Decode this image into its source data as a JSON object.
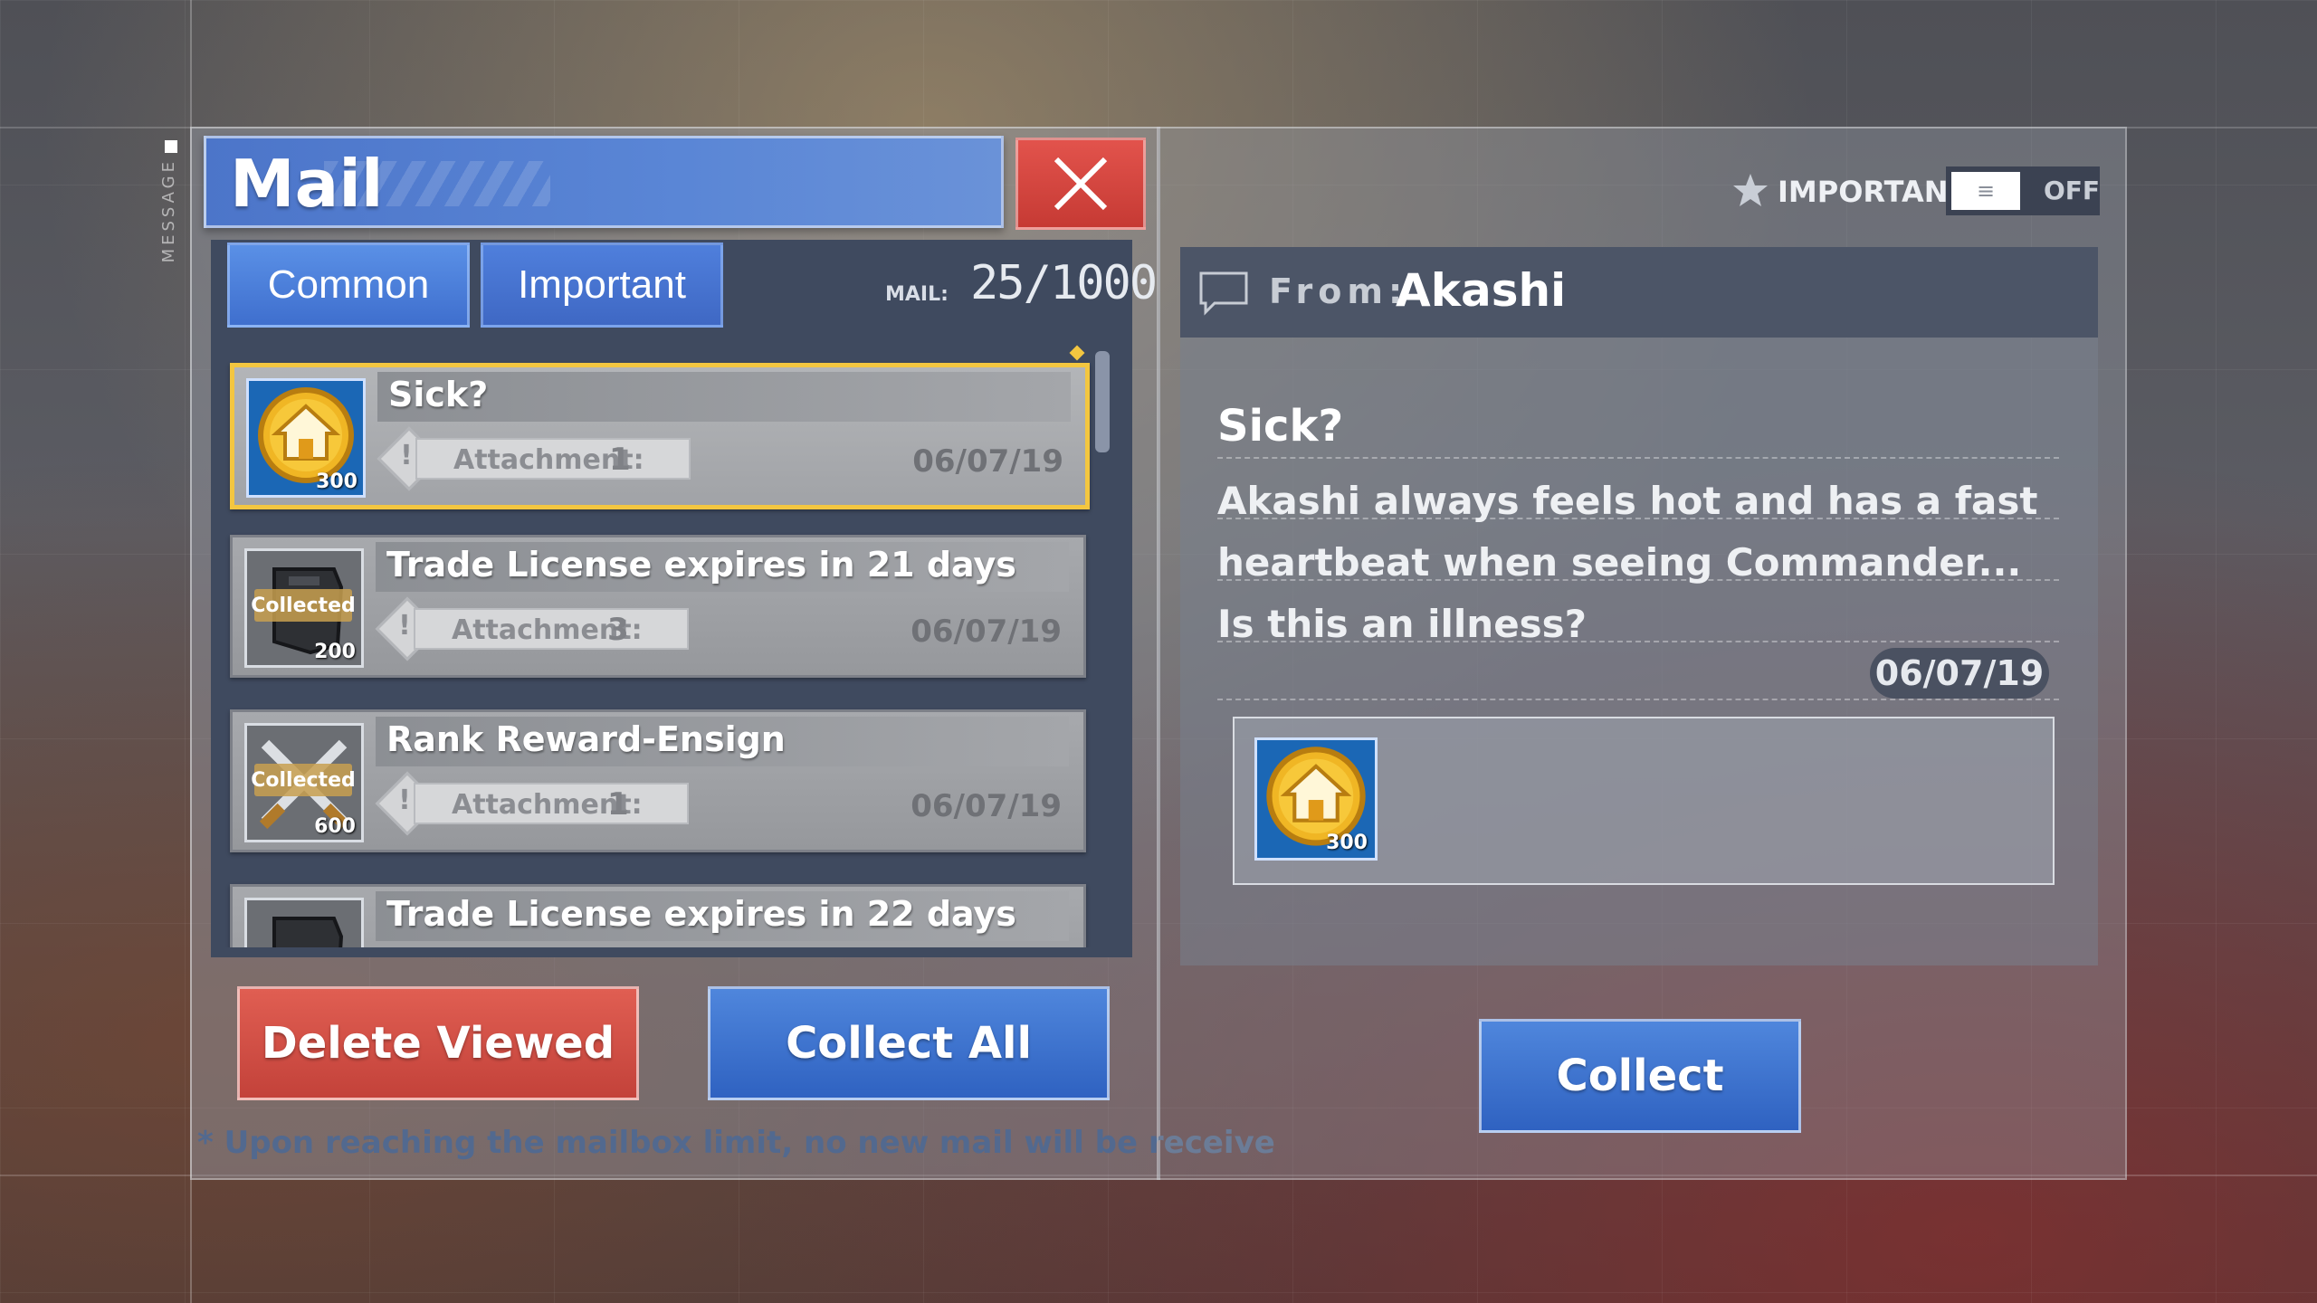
{
  "window": {
    "side_label": "MESSAGE"
  },
  "header": {
    "title": "Mail"
  },
  "tabs": [
    {
      "label": "Common"
    },
    {
      "label": "Important"
    }
  ],
  "mailbox": {
    "count_label": "MAIL:",
    "count": "25/1000"
  },
  "mail_list": [
    {
      "title": "Sick?",
      "attachment_label": "Attachment:",
      "attachment_count": "1",
      "date": "06/07/19",
      "reward_qty": "300",
      "status": "",
      "icon": "home-coin-icon"
    },
    {
      "title": "Trade License expires in 21 days",
      "attachment_label": "Attachment:",
      "attachment_count": "3",
      "date": "06/07/19",
      "reward_qty": "200",
      "status": "Collected",
      "icon": "trade-license-icon"
    },
    {
      "title": "Rank Reward-Ensign",
      "attachment_label": "Attachment:",
      "attachment_count": "1",
      "date": "06/07/19",
      "reward_qty": "600",
      "status": "Collected",
      "icon": "crossed-swords-icon"
    },
    {
      "title": "Trade License expires in 22 days",
      "icon": "trade-license-icon"
    }
  ],
  "actions": {
    "delete_viewed": "Delete Viewed",
    "collect_all": "Collect All",
    "collect": "Collect"
  },
  "footer": {
    "note": "* Upon reaching the mailbox limit, no new mail will be receive"
  },
  "detail": {
    "important_label": "IMPORTANT",
    "toggle_state": "OFF",
    "from_label": "From:",
    "from_name": "Akashi",
    "title": "Sick?",
    "body": "Akashi always feels hot and has a fast heartbeat when seeing Commander... Is this an illness?",
    "date": "06/07/19",
    "attachment_qty": "300"
  },
  "colors": {
    "accent_blue": "#3f6fce",
    "danger_red": "#c3423a",
    "highlight_gold": "#f3c640"
  }
}
